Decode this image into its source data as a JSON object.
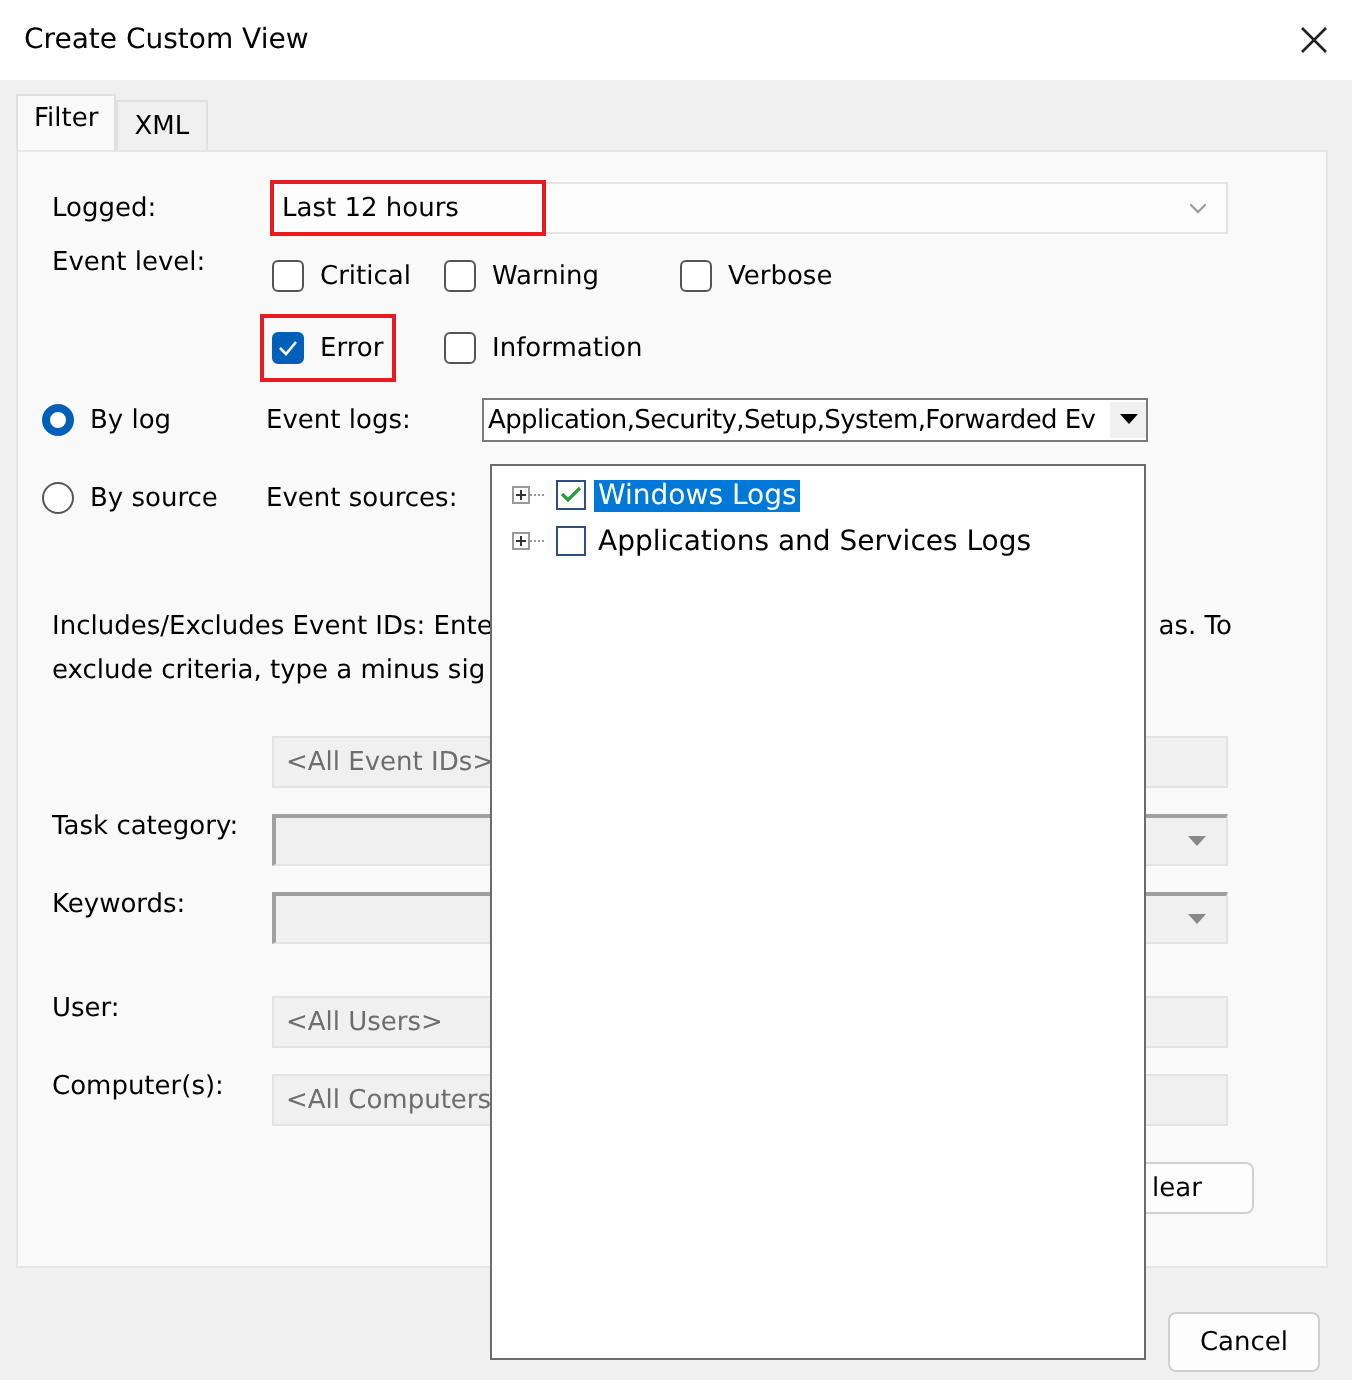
{
  "window": {
    "title": "Create Custom View"
  },
  "tabs": [
    {
      "label": "Filter",
      "selected": true
    },
    {
      "label": "XML",
      "selected": false
    }
  ],
  "logged": {
    "label": "Logged:",
    "value": "Last 12 hours",
    "highlighted": true
  },
  "event_level": {
    "label": "Event level:",
    "rows": [
      [
        {
          "label": "Critical",
          "checked": false,
          "highlighted": false
        },
        {
          "label": "Warning",
          "checked": false,
          "highlighted": false
        },
        {
          "label": "Verbose",
          "checked": false,
          "highlighted": false
        }
      ],
      [
        {
          "label": "Error",
          "checked": true,
          "highlighted": true
        },
        {
          "label": "Information",
          "checked": false,
          "highlighted": false
        }
      ]
    ]
  },
  "source_mode": [
    {
      "label": "By log",
      "selected": true,
      "field_label": "Event logs:",
      "value": "Application,Security,Setup,System,Forwarded Ev"
    },
    {
      "label": "By source",
      "selected": false,
      "field_label": "Event sources:"
    }
  ],
  "description": {
    "left_lines": [
      "Includes/Excludes Event IDs: Ente",
      "exclude criteria, type a minus sig"
    ],
    "right_text": "as. To"
  },
  "fields": [
    {
      "kind": "text",
      "placeholder": "<All Event IDs>"
    },
    {
      "kind": "combo",
      "label": "Task category:"
    },
    {
      "kind": "combo",
      "label": "Keywords:"
    },
    {
      "kind": "text",
      "label": "User:",
      "placeholder": "<All Users>"
    },
    {
      "kind": "text",
      "label": "Computer(s):",
      "placeholder": "<All Computers"
    }
  ],
  "clear_button": "lear",
  "cancel_button": "Cancel",
  "log_tree": [
    {
      "label": "Windows Logs",
      "checked": true,
      "selected": true
    },
    {
      "label": "Applications and Services Logs",
      "checked": false,
      "selected": false
    }
  ]
}
